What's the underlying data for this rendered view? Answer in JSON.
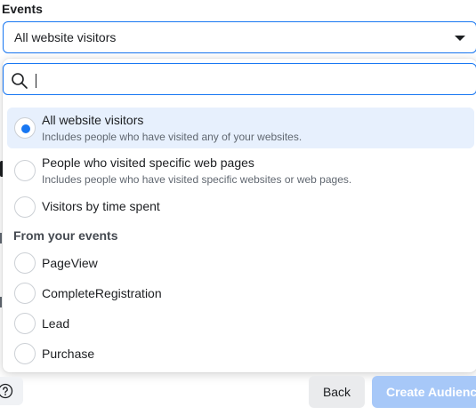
{
  "events": {
    "label": "Events",
    "selected_value": "All website visitors"
  },
  "search": {
    "placeholder": "",
    "value": ""
  },
  "options": [
    {
      "title": "All website visitors",
      "subtitle": "Includes people who have visited any of your websites.",
      "selected": true
    },
    {
      "title": "People who visited specific web pages",
      "subtitle": "Includes people who have visited specific websites or web pages.",
      "selected": false
    },
    {
      "title": "Visitors by time spent",
      "subtitle": "",
      "selected": false
    }
  ],
  "events_section": {
    "heading": "From your events",
    "items": [
      {
        "title": "PageView"
      },
      {
        "title": "CompleteRegistration"
      },
      {
        "title": "Lead"
      },
      {
        "title": "Purchase"
      }
    ]
  },
  "footer": {
    "back_label": "Back",
    "create_label": "Create Audience"
  },
  "colors": {
    "accent": "#1877f2",
    "selected_bg": "#e7f0fd",
    "disabled_primary": "#a7c8f8"
  },
  "icons": {
    "search": "search-icon",
    "caret": "caret-down-icon",
    "help": "help-icon"
  }
}
